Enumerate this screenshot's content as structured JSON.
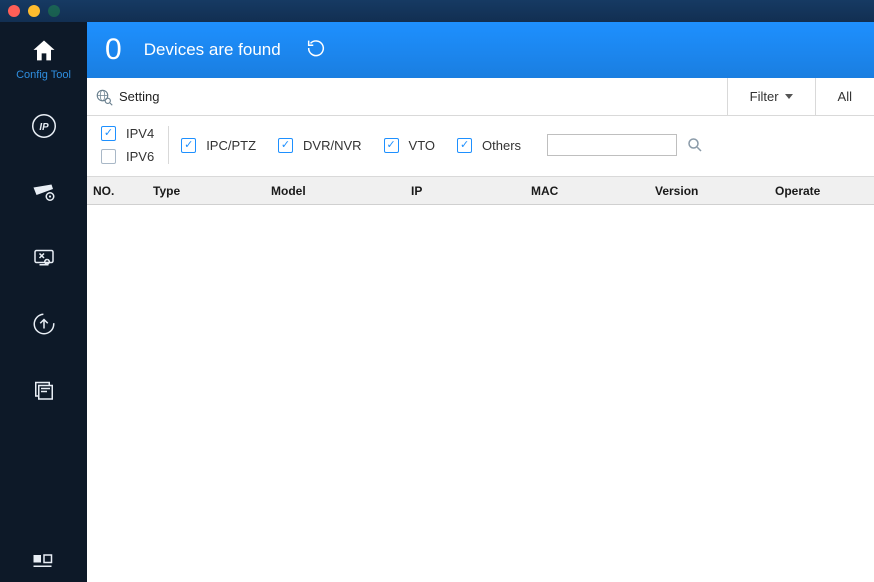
{
  "sidebar": {
    "home_label": "Config Tool"
  },
  "header": {
    "count": "0",
    "title": "Devices are found"
  },
  "toolbar": {
    "setting": "Setting",
    "filter": "Filter",
    "all": "All"
  },
  "filters": {
    "ipv4": "IPV4",
    "ipv6": "IPV6",
    "ipc": "IPC/PTZ",
    "dvr": "DVR/NVR",
    "vto": "VTO",
    "others": "Others",
    "search_value": ""
  },
  "columns": {
    "no": "NO.",
    "type": "Type",
    "model": "Model",
    "ip": "IP",
    "mac": "MAC",
    "version": "Version",
    "operate": "Operate"
  },
  "rows": []
}
